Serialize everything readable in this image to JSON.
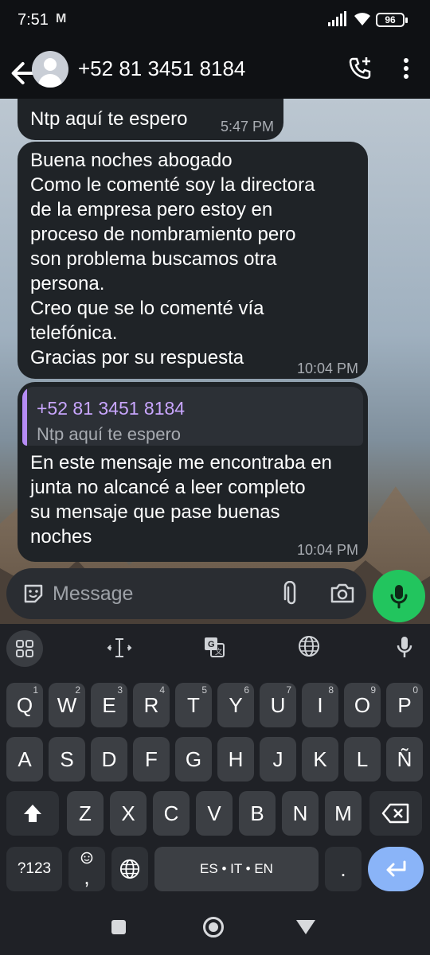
{
  "status_bar": {
    "time": "7:51",
    "battery": "96",
    "notification_icon": "gmail-icon"
  },
  "header": {
    "contact": "+52 81 3451 8184",
    "icons": [
      "back-arrow-icon",
      "avatar",
      "add-call-icon",
      "more-vert-icon"
    ]
  },
  "messages": [
    {
      "text": "Ntp aquí te espero",
      "time": "5:47 PM"
    },
    {
      "lines": [
        "Buena noches abogado",
        "Como le comenté soy la directora",
        "de la empresa pero estoy en",
        "proceso de nombramiento pero",
        "son problema buscamos otra",
        "persona.",
        "Creo que se lo comenté vía",
        "telefónica.",
        "Gracias por su respuesta"
      ],
      "time": "10:04 PM"
    },
    {
      "quote": {
        "name": "+52 81 3451 8184",
        "text": "Ntp aquí te espero"
      },
      "lines": [
        "En este mensaje me encontraba en",
        "junta no alcancé a leer completo",
        "su mensaje que pase buenas",
        "noches"
      ],
      "time": "10:04 PM"
    }
  ],
  "compose": {
    "placeholder": "Message"
  },
  "keyboard": {
    "row1": [
      "Q",
      "W",
      "E",
      "R",
      "T",
      "Y",
      "U",
      "I",
      "O",
      "P"
    ],
    "row1_hints": [
      "1",
      "2",
      "3",
      "4",
      "5",
      "6",
      "7",
      "8",
      "9",
      "0"
    ],
    "row2": [
      "A",
      "S",
      "D",
      "F",
      "G",
      "H",
      "J",
      "K",
      "L",
      "Ñ"
    ],
    "row3": [
      "Z",
      "X",
      "C",
      "V",
      "B",
      "N",
      "M"
    ],
    "symbols": "?123",
    "comma": ",",
    "period": ".",
    "space": "ES • IT • EN"
  },
  "colors": {
    "accent": "#22c55e",
    "quote_bar": "#b68cf5",
    "enter": "#8ab4f8"
  }
}
